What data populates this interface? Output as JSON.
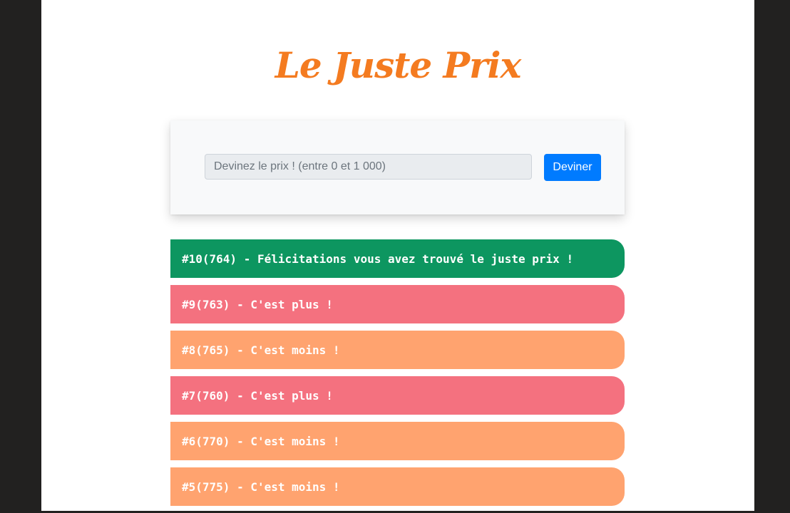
{
  "title": "Le Juste Prix",
  "colors": {
    "title": "#f47b20",
    "button": "#007bff",
    "success": "#0d9660",
    "plus": "#f4717f",
    "moins": "#ffa36f"
  },
  "form": {
    "placeholder": "Devinez le prix ! (entre 0 et 1 000)",
    "value": "",
    "button_label": "Deviner"
  },
  "history": [
    {
      "text": "#10(764) - Félicitations vous avez trouvé le juste prix !",
      "status": "success"
    },
    {
      "text": "#9(763) - C'est plus !",
      "status": "plus"
    },
    {
      "text": "#8(765) - C'est moins !",
      "status": "moins"
    },
    {
      "text": "#7(760) - C'est plus !",
      "status": "plus"
    },
    {
      "text": "#6(770) - C'est moins !",
      "status": "moins"
    },
    {
      "text": "#5(775) - C'est moins !",
      "status": "moins"
    }
  ]
}
